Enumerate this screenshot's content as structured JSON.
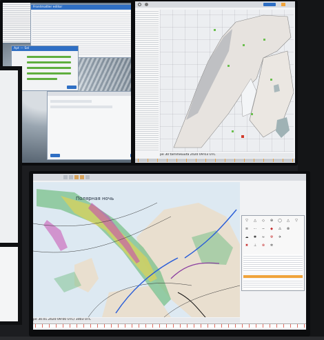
{
  "top_left_monitor": {
    "main_window": {
      "title": "Frontmatter editor"
    },
    "panel_window": {
      "title": "Apt — Sel"
    },
    "dialog_window": {
      "title": ""
    }
  },
  "top_right_monitor": {
    "map_status_text": "pe 30 tammikuuta 2020 09:03 UTC"
  },
  "bottom_monitor": {
    "map_annotation": "Полярная ночь",
    "status_text": "pe 30.01.2020 09:00 UTC/ 3d03 UTC"
  },
  "colors": {
    "brand_blue": "#2f6fc4",
    "station_green": "#6bbf4e",
    "front_blue": "#2c5fd8",
    "warning_orange": "#f0a33a",
    "precip_magenta": "#c64fb0"
  }
}
